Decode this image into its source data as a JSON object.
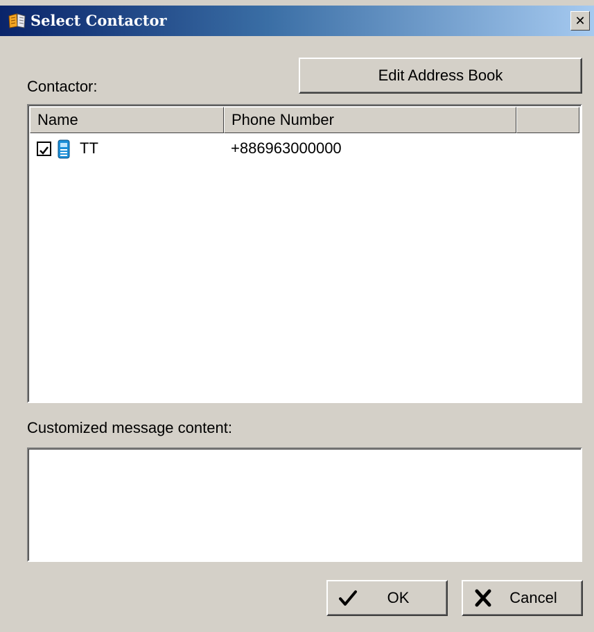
{
  "window": {
    "title": "Select Contactor",
    "icon": "app-book-icon",
    "close_label": "✕"
  },
  "contactor_label": "Contactor:",
  "edit_button_label": "Edit Address Book",
  "list": {
    "columns": [
      "Name",
      "Phone Number",
      ""
    ],
    "rows": [
      {
        "checked": true,
        "icon": "phone-icon",
        "name": "TT",
        "phone": "+886963000000"
      }
    ]
  },
  "message_label": "Customized message content:",
  "message_value": "",
  "buttons": {
    "ok_label": "OK",
    "cancel_label": "Cancel"
  },
  "colors": {
    "titlebar_start": "#0a246a",
    "titlebar_end": "#a6caf0",
    "dialog_bg": "#d4d0c8"
  }
}
